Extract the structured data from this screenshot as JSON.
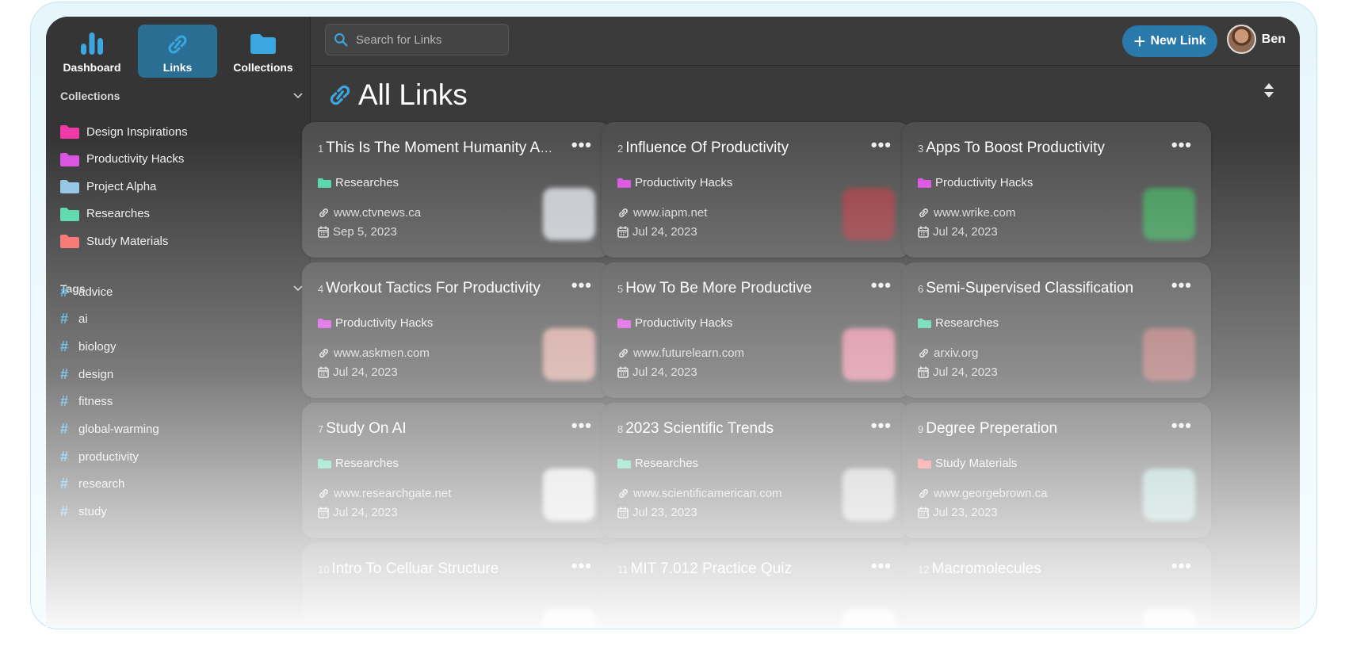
{
  "nav": {
    "dashboard": "Dashboard",
    "links": "Links",
    "collections": "Collections"
  },
  "sidebar": {
    "collections_heading": "Collections",
    "collections": [
      {
        "name": "Design Inspirations",
        "color": "#f03aa8"
      },
      {
        "name": "Productivity Hacks",
        "color": "#d94fe0"
      },
      {
        "name": "Project Alpha",
        "color": "#8ec2e0"
      },
      {
        "name": "Researches",
        "color": "#4ed5a6"
      },
      {
        "name": "Study Materials",
        "color": "#f46360"
      }
    ],
    "tags_heading": "Tags",
    "tags": [
      "advice",
      "ai",
      "biology",
      "design",
      "fitness",
      "global-warming",
      "productivity",
      "research",
      "study"
    ]
  },
  "topbar": {
    "search_placeholder": "Search for Links",
    "new_link_label": "New Link",
    "user_name": "Ben"
  },
  "page": {
    "title": "All Links"
  },
  "links": [
    {
      "num": "1",
      "title": "This Is The Moment Humanity Alm...",
      "collection": "Researches",
      "collection_color": "#4ed5a6",
      "url": "www.ctvnews.ca",
      "date": "Sep 5, 2023",
      "thumb": "#d9dde3"
    },
    {
      "num": "2",
      "title": "Influence Of Productivity",
      "collection": "Productivity Hacks",
      "collection_color": "#d94fe0",
      "url": "www.iapm.net",
      "date": "Jul 24, 2023",
      "thumb": "#a33a42"
    },
    {
      "num": "3",
      "title": "Apps To Boost Productivity",
      "collection": "Productivity Hacks",
      "collection_color": "#d94fe0",
      "url": "www.wrike.com",
      "date": "Jul 24, 2023",
      "thumb": "#3da35a"
    },
    {
      "num": "4",
      "title": "Workout Tactics For Productivity",
      "collection": "Productivity Hacks",
      "collection_color": "#d94fe0",
      "url": "www.askmen.com",
      "date": "Jul 24, 2023",
      "thumb": "#e3a9a1"
    },
    {
      "num": "5",
      "title": "How To Be More Productive",
      "collection": "Productivity Hacks",
      "collection_color": "#d94fe0",
      "url": "www.futurelearn.com",
      "date": "Jul 24, 2023",
      "thumb": "#ee8aa4"
    },
    {
      "num": "6",
      "title": "Semi-Supervised Classification",
      "collection": "Researches",
      "collection_color": "#4ed5a6",
      "url": "arxiv.org",
      "date": "Jul 24, 2023",
      "thumb": "#b56b6b"
    },
    {
      "num": "7",
      "title": "Study On AI",
      "collection": "Researches",
      "collection_color": "#4ed5a6",
      "url": "www.researchgate.net",
      "date": "Jul 24, 2023",
      "thumb": "#eeeeee"
    },
    {
      "num": "8",
      "title": "2023 Scientific Trends",
      "collection": "Researches",
      "collection_color": "#4ed5a6",
      "url": "www.scientificamerican.com",
      "date": "Jul 23, 2023",
      "thumb": "#cfcfcf"
    },
    {
      "num": "9",
      "title": "Degree Preperation",
      "collection": "Study Materials",
      "collection_color": "#f46360",
      "url": "www.georgebrown.ca",
      "date": "Jul 23, 2023",
      "thumb": "#9ed3c9"
    },
    {
      "num": "10",
      "title": "Intro To Celluar Structure",
      "collection": "",
      "collection_color": "#4ed5a6",
      "url": "",
      "date": "",
      "thumb": "#eeeeee"
    },
    {
      "num": "11",
      "title": "MIT 7.012 Practice Quiz",
      "collection": "",
      "collection_color": "#4ed5a6",
      "url": "",
      "date": "",
      "thumb": "#eeeeee"
    },
    {
      "num": "12",
      "title": "Macromolecules",
      "collection": "",
      "collection_color": "#4ed5a6",
      "url": "",
      "date": "",
      "thumb": "#eeeeee"
    }
  ],
  "colors": {
    "accent": "#2a79ab",
    "icon_blue": "#3ba6e0",
    "card_bg": "#4f4f4f"
  }
}
